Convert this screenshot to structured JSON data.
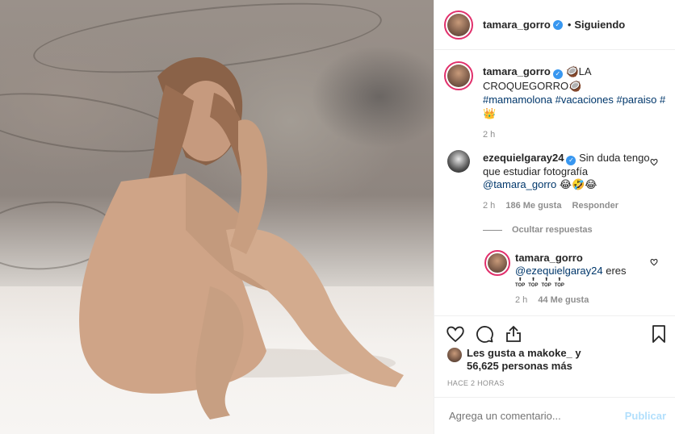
{
  "post": {
    "username": "tamara_gorro",
    "dot": "•",
    "follow_status": "Siguiendo",
    "caption_emoji_a": "🥥",
    "caption_title": "LA CROQUEGORRO",
    "caption_emoji_b": "🥥",
    "hashtags": "#mamamolona #vacaciones #paraiso #",
    "caption_emoji_c": "👑",
    "caption_time": "2 h"
  },
  "comments": [
    {
      "username": "ezequielgaray24",
      "text": "Sin duda tengo que estudiar fotografía",
      "mention": "@tamara_gorro",
      "emojis": "😂🤣😂",
      "time": "2 h",
      "likes": "186 Me gusta",
      "reply": "Responder",
      "toggle_replies": "Ocultar respuestas"
    }
  ],
  "reply": {
    "username": "tamara_gorro",
    "mention": "@ezequielgaray24",
    "text": "eres",
    "top_badges": [
      "TOP",
      "TOP",
      "TOP",
      "TOP"
    ],
    "time": "2 h",
    "likes": "44 Me gusta"
  },
  "likes_summary": {
    "line1": "Les gusta a makoke_ y",
    "line2": "56,625 personas más"
  },
  "posted_ago": "HACE 2 HORAS",
  "comment_box": {
    "placeholder": "Agrega un comentario...",
    "submit": "Publicar"
  },
  "colors": {
    "verified": "#3897f0",
    "link": "#00376b",
    "publish_disabled": "#b2dffc",
    "story_ring": "#e1306c"
  },
  "icons": [
    "heart-icon",
    "comment-icon",
    "share-icon",
    "bookmark-icon",
    "verified-icon"
  ]
}
